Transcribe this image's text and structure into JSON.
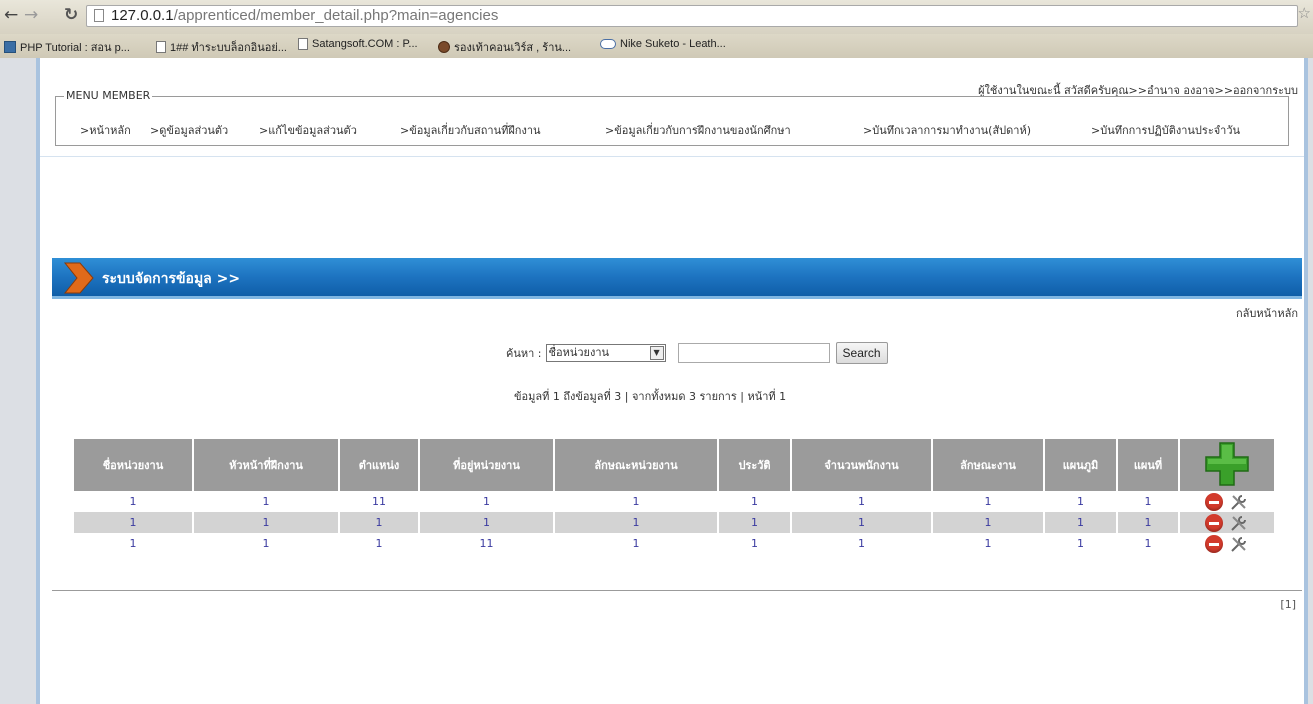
{
  "browser": {
    "url_host": "127.0.0.1",
    "url_path": "/apprenticed/member_detail.php?main=agencies",
    "bookmarks": [
      "PHP Tutorial : สอน p...",
      "1## ทำระบบล็อกอินอย่...",
      "Satangsoft.COM : P...",
      "รองเท้าคอนเวิร์ส , ร้าน...",
      "Nike Suketo - Leath..."
    ]
  },
  "header": {
    "welcome": "ผู้ใช้งานในขณะนี้ สวัสดีครับคุณ>>",
    "username": "อำนาจ องอาจ",
    "logout": ">>ออกจากระบบ"
  },
  "menu": {
    "legend": "MENU MEMBER",
    "items": [
      ">หน้าหลัก",
      ">ดูข้อมูลส่วนตัว",
      ">แก้ไขข้อมูลส่วนตัว",
      ">ข้อมูลเกี่ยวกับสถานที่ฝึกงาน",
      ">ข้อมูลเกี่ยวกับการฝึกงานของนักศึกษา",
      ">บันทึกเวลาการมาทำงาน(สัปดาห์)",
      ">บันทึกการปฏิบัติงานประจำวัน"
    ]
  },
  "section": {
    "title": "ระบบจัดการข้อมูล >>",
    "back_link": "กลับหน้าหลัก"
  },
  "search": {
    "label": "ค้นหา :",
    "selected": "ชื่อหน่วยงาน",
    "value": "",
    "button": "Search"
  },
  "record_info": "ข้อมูลที่ 1 ถึงข้อมูลที่ 3 | จากทั้งหมด 3 รายการ | หน้าที่ 1",
  "table": {
    "headers": [
      "ชื่อหน่วยงาน",
      "หัวหน้าที่ฝึกงาน",
      "ตำแหน่ง",
      "ที่อยู่หน่วยงาน",
      "ลักษณะหน่วยงาน",
      "ประวัติ",
      "จำนวนพนักงาน",
      "ลักษณะงาน",
      "แผนภูมิ",
      "แผนที่"
    ],
    "rows": [
      [
        "1",
        "1",
        "11",
        "1",
        "1",
        "1",
        "1",
        "1",
        "1",
        "1"
      ],
      [
        "1",
        "1",
        "1",
        "1",
        "1",
        "1",
        "1",
        "1",
        "1",
        "1"
      ],
      [
        "1",
        "1",
        "1",
        "11",
        "1",
        "1",
        "1",
        "1",
        "1",
        "1"
      ]
    ]
  },
  "pager": "[1]",
  "colors": {
    "section_bar": "#1d73c0",
    "table_header": "#9b9b9b",
    "row_alt": "#d3d3d3",
    "cell_text": "#3a3aa0",
    "add_icon": "#3aa02a",
    "delete_icon": "#d23a2c"
  },
  "icons": {
    "add": "plus-icon",
    "delete": "minus-circle-icon",
    "edit": "wrench-icon",
    "section": "chevron-right-icon"
  }
}
